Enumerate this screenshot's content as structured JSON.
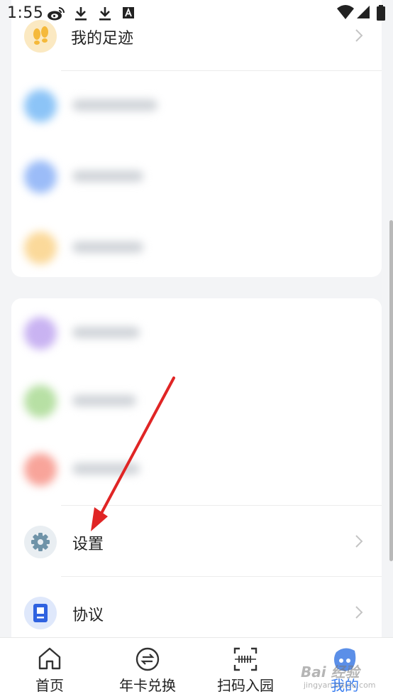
{
  "status_bar": {
    "time": "1:55",
    "icons": [
      "weibo-icon",
      "download-icon",
      "download-icon",
      "font-a-icon"
    ],
    "right_icons": [
      "wifi-icon",
      "signal-icon",
      "battery-icon"
    ]
  },
  "menu": {
    "footprints_label": "我的足迹",
    "settings_label": "设置",
    "agreement_label": "协议",
    "blurred_icon_colors": [
      "#8cc4f7",
      "#9bbcf8",
      "#fbd99a",
      "#c9b3f2",
      "#b7e0a4",
      "#f8a49a"
    ]
  },
  "tabbar": {
    "home": "首页",
    "card_exchange": "年卡兑换",
    "scan_entry": "扫码入园",
    "mine": "我的"
  },
  "colors": {
    "accent": "#3a7ef0",
    "arrow": "#e02525"
  },
  "watermark": {
    "text": "Bai 经验",
    "sub": "jingyan.baidu.com"
  }
}
